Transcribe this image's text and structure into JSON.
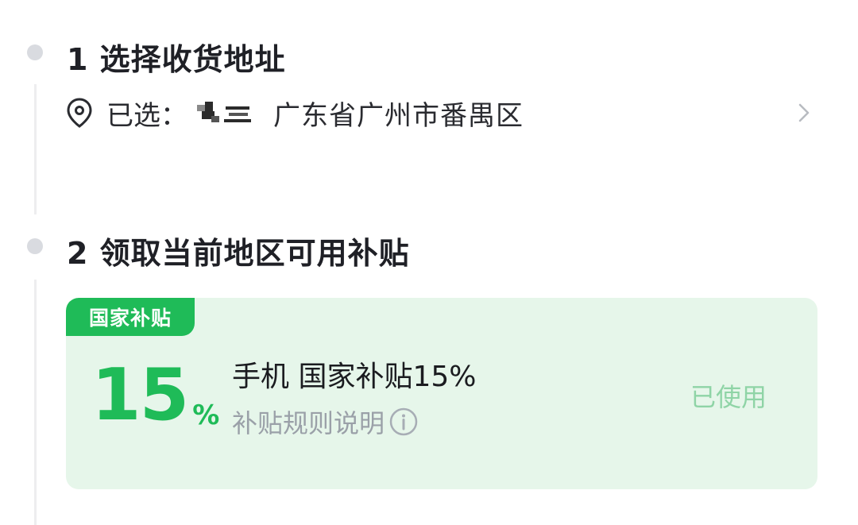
{
  "steps": [
    {
      "title": "1 选择收货地址"
    },
    {
      "title": "2 领取当前地区可用补贴"
    }
  ],
  "address": {
    "prefix": "已选：",
    "region": "广东省广州市番禺区",
    "icon": "location-pin-icon",
    "chevron": "chevron-right-icon"
  },
  "subsidy_card": {
    "tag": "国家补贴",
    "rate_value": "15",
    "rate_unit": "%",
    "title": "手机 国家补贴15%",
    "rule_link": "补贴规则说明",
    "status": "已使用",
    "colors": {
      "accent": "#1fbb58",
      "card_bg": "#e6f6ea",
      "status": "#8fd4a6"
    }
  }
}
